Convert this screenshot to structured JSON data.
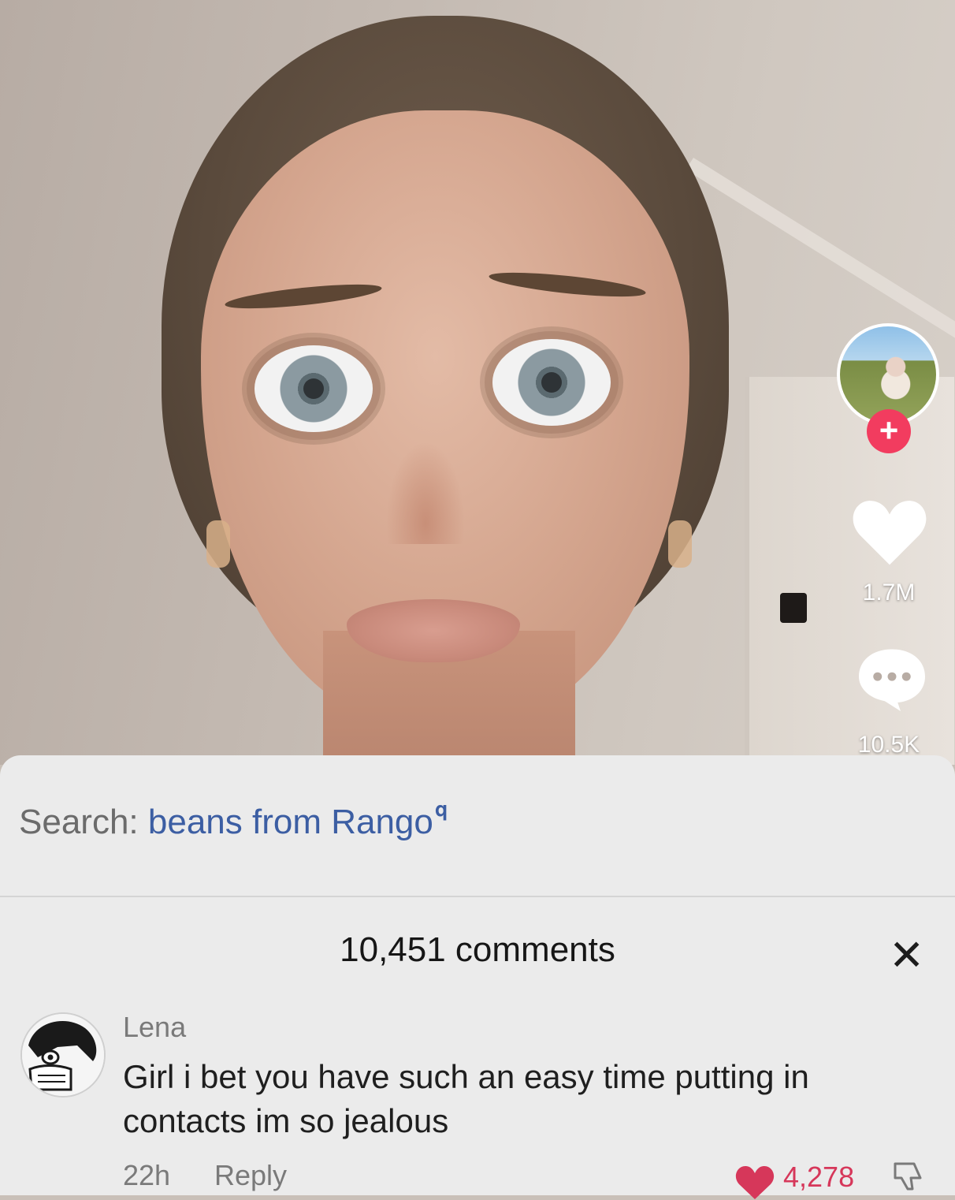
{
  "video": {
    "likes": "1.7M",
    "comments": "10.5K"
  },
  "colors": {
    "accent": "#f23c5f",
    "search_query": "#3c5ea3",
    "like_heart": "#d6375a"
  },
  "search": {
    "prefix": "Search:",
    "query": "beans from Rango"
  },
  "comments_panel": {
    "title": "10,451 comments",
    "close_icon": "close-icon",
    "comment": {
      "author": "Lena",
      "text": "Girl i bet you have such an easy time putting in contacts im so jealous",
      "time": "22h",
      "reply_label": "Reply",
      "likes": "4,278"
    }
  },
  "icons": [
    "follow-plus-icon",
    "heart-icon",
    "comment-icon",
    "search-icon",
    "close-icon",
    "dislike-icon"
  ]
}
